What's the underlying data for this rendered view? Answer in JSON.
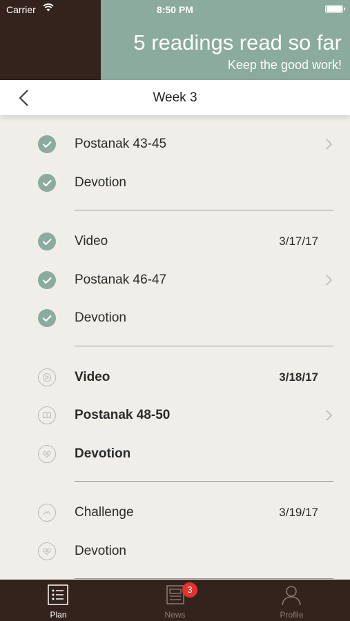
{
  "status_bar": {
    "carrier": "Carrier",
    "time": "8:50 PM"
  },
  "banner": {
    "title": "5 readings read so far",
    "subtitle": "Keep the good work!"
  },
  "nav": {
    "title": "Week 3"
  },
  "days": [
    {
      "items": [
        {
          "label": "Postanak 43-45",
          "state": "done",
          "icon": "check-icon",
          "chevron": true
        },
        {
          "label": "Devotion",
          "state": "done",
          "icon": "check-icon"
        }
      ]
    },
    {
      "items": [
        {
          "label": "Video",
          "state": "done",
          "icon": "check-icon",
          "date": "3/17/17"
        },
        {
          "label": "Postanak 46-47",
          "state": "done",
          "icon": "check-icon",
          "chevron": true
        },
        {
          "label": "Devotion",
          "state": "done",
          "icon": "check-icon"
        }
      ]
    },
    {
      "items": [
        {
          "label": "Video",
          "state": "current",
          "icon": "play-icon",
          "date": "3/18/17"
        },
        {
          "label": "Postanak 48-50",
          "state": "current",
          "icon": "book-icon",
          "chevron": true
        },
        {
          "label": "Devotion",
          "state": "current",
          "icon": "heart-icon"
        }
      ]
    },
    {
      "items": [
        {
          "label": "Challenge",
          "state": "upcoming",
          "icon": "mountain-icon",
          "date": "3/19/17"
        },
        {
          "label": "Devotion",
          "state": "upcoming",
          "icon": "heart-icon"
        }
      ]
    }
  ],
  "tabbar": {
    "tabs": [
      {
        "label": "Plan",
        "icon": "list-icon",
        "active": true
      },
      {
        "label": "News",
        "icon": "news-icon",
        "badge": "3"
      },
      {
        "label": "Profile",
        "icon": "person-icon"
      }
    ]
  },
  "colors": {
    "brand_dark": "#34231c",
    "accent_green": "#8aab9d",
    "background": "#efeee9",
    "badge_red": "#e5322b"
  }
}
